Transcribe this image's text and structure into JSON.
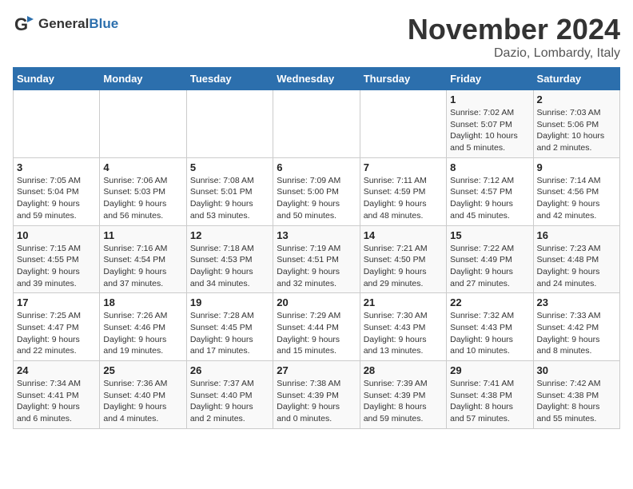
{
  "header": {
    "logo_general": "General",
    "logo_blue": "Blue",
    "month_title": "November 2024",
    "location": "Dazio, Lombardy, Italy"
  },
  "weekdays": [
    "Sunday",
    "Monday",
    "Tuesday",
    "Wednesday",
    "Thursday",
    "Friday",
    "Saturday"
  ],
  "weeks": [
    [
      {
        "day": "",
        "info": ""
      },
      {
        "day": "",
        "info": ""
      },
      {
        "day": "",
        "info": ""
      },
      {
        "day": "",
        "info": ""
      },
      {
        "day": "",
        "info": ""
      },
      {
        "day": "1",
        "info": "Sunrise: 7:02 AM\nSunset: 5:07 PM\nDaylight: 10 hours\nand 5 minutes."
      },
      {
        "day": "2",
        "info": "Sunrise: 7:03 AM\nSunset: 5:06 PM\nDaylight: 10 hours\nand 2 minutes."
      }
    ],
    [
      {
        "day": "3",
        "info": "Sunrise: 7:05 AM\nSunset: 5:04 PM\nDaylight: 9 hours\nand 59 minutes."
      },
      {
        "day": "4",
        "info": "Sunrise: 7:06 AM\nSunset: 5:03 PM\nDaylight: 9 hours\nand 56 minutes."
      },
      {
        "day": "5",
        "info": "Sunrise: 7:08 AM\nSunset: 5:01 PM\nDaylight: 9 hours\nand 53 minutes."
      },
      {
        "day": "6",
        "info": "Sunrise: 7:09 AM\nSunset: 5:00 PM\nDaylight: 9 hours\nand 50 minutes."
      },
      {
        "day": "7",
        "info": "Sunrise: 7:11 AM\nSunset: 4:59 PM\nDaylight: 9 hours\nand 48 minutes."
      },
      {
        "day": "8",
        "info": "Sunrise: 7:12 AM\nSunset: 4:57 PM\nDaylight: 9 hours\nand 45 minutes."
      },
      {
        "day": "9",
        "info": "Sunrise: 7:14 AM\nSunset: 4:56 PM\nDaylight: 9 hours\nand 42 minutes."
      }
    ],
    [
      {
        "day": "10",
        "info": "Sunrise: 7:15 AM\nSunset: 4:55 PM\nDaylight: 9 hours\nand 39 minutes."
      },
      {
        "day": "11",
        "info": "Sunrise: 7:16 AM\nSunset: 4:54 PM\nDaylight: 9 hours\nand 37 minutes."
      },
      {
        "day": "12",
        "info": "Sunrise: 7:18 AM\nSunset: 4:53 PM\nDaylight: 9 hours\nand 34 minutes."
      },
      {
        "day": "13",
        "info": "Sunrise: 7:19 AM\nSunset: 4:51 PM\nDaylight: 9 hours\nand 32 minutes."
      },
      {
        "day": "14",
        "info": "Sunrise: 7:21 AM\nSunset: 4:50 PM\nDaylight: 9 hours\nand 29 minutes."
      },
      {
        "day": "15",
        "info": "Sunrise: 7:22 AM\nSunset: 4:49 PM\nDaylight: 9 hours\nand 27 minutes."
      },
      {
        "day": "16",
        "info": "Sunrise: 7:23 AM\nSunset: 4:48 PM\nDaylight: 9 hours\nand 24 minutes."
      }
    ],
    [
      {
        "day": "17",
        "info": "Sunrise: 7:25 AM\nSunset: 4:47 PM\nDaylight: 9 hours\nand 22 minutes."
      },
      {
        "day": "18",
        "info": "Sunrise: 7:26 AM\nSunset: 4:46 PM\nDaylight: 9 hours\nand 19 minutes."
      },
      {
        "day": "19",
        "info": "Sunrise: 7:28 AM\nSunset: 4:45 PM\nDaylight: 9 hours\nand 17 minutes."
      },
      {
        "day": "20",
        "info": "Sunrise: 7:29 AM\nSunset: 4:44 PM\nDaylight: 9 hours\nand 15 minutes."
      },
      {
        "day": "21",
        "info": "Sunrise: 7:30 AM\nSunset: 4:43 PM\nDaylight: 9 hours\nand 13 minutes."
      },
      {
        "day": "22",
        "info": "Sunrise: 7:32 AM\nSunset: 4:43 PM\nDaylight: 9 hours\nand 10 minutes."
      },
      {
        "day": "23",
        "info": "Sunrise: 7:33 AM\nSunset: 4:42 PM\nDaylight: 9 hours\nand 8 minutes."
      }
    ],
    [
      {
        "day": "24",
        "info": "Sunrise: 7:34 AM\nSunset: 4:41 PM\nDaylight: 9 hours\nand 6 minutes."
      },
      {
        "day": "25",
        "info": "Sunrise: 7:36 AM\nSunset: 4:40 PM\nDaylight: 9 hours\nand 4 minutes."
      },
      {
        "day": "26",
        "info": "Sunrise: 7:37 AM\nSunset: 4:40 PM\nDaylight: 9 hours\nand 2 minutes."
      },
      {
        "day": "27",
        "info": "Sunrise: 7:38 AM\nSunset: 4:39 PM\nDaylight: 9 hours\nand 0 minutes."
      },
      {
        "day": "28",
        "info": "Sunrise: 7:39 AM\nSunset: 4:39 PM\nDaylight: 8 hours\nand 59 minutes."
      },
      {
        "day": "29",
        "info": "Sunrise: 7:41 AM\nSunset: 4:38 PM\nDaylight: 8 hours\nand 57 minutes."
      },
      {
        "day": "30",
        "info": "Sunrise: 7:42 AM\nSunset: 4:38 PM\nDaylight: 8 hours\nand 55 minutes."
      }
    ]
  ]
}
